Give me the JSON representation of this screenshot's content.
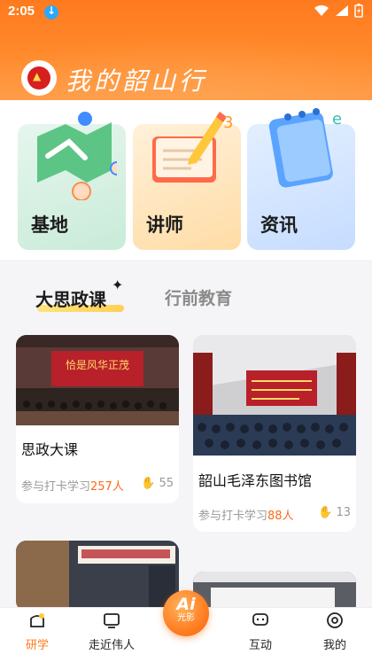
{
  "status_bar": {
    "time": "2:05"
  },
  "header": {
    "title": "我的韶山行"
  },
  "categories": [
    {
      "label": "基地"
    },
    {
      "label": "讲师"
    },
    {
      "label": "资讯"
    }
  ],
  "tabs": [
    {
      "label": "大思政课",
      "active": true
    },
    {
      "label": "行前教育",
      "active": false
    }
  ],
  "feed": [
    {
      "title": "思政大课",
      "meta_prefix": "参与打卡学习",
      "count": "257人",
      "likes": "55"
    },
    {
      "title": "韶山毛泽东图书馆",
      "meta_prefix": "参与打卡学习",
      "count": "88人",
      "likes": "13"
    }
  ],
  "bottom_nav": {
    "items": [
      {
        "label": "研学",
        "active": true
      },
      {
        "label": "走近伟人",
        "active": false
      },
      {
        "label": "互动",
        "active": false
      },
      {
        "label": "我的",
        "active": false
      }
    ],
    "ai": {
      "label": "Ai",
      "sub": "光影"
    }
  },
  "colors": {
    "accent": "#ff7a1e",
    "highlight_count": "#ff6a1a"
  }
}
